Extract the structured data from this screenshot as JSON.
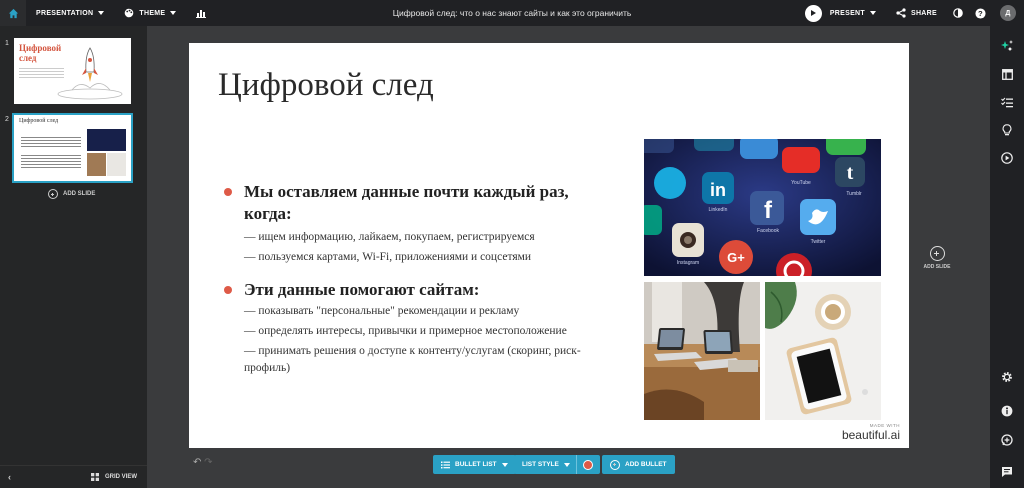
{
  "topbar": {
    "presentation_label": "PRESENTATION",
    "theme_label": "THEME",
    "doc_title": "Цифровой след: что о нас знают сайты и как это ограничить",
    "present_label": "PRESENT",
    "share_label": "SHARE",
    "avatar_initial": "Д"
  },
  "sidebar": {
    "slides": [
      {
        "number": "1",
        "title": "Цифровой след"
      },
      {
        "number": "2",
        "title": "Цифровой след"
      }
    ],
    "add_slide_label": "ADD SLIDE",
    "grid_view_label": "GRID VIEW"
  },
  "slide": {
    "title": "Цифровой след",
    "bullets": [
      {
        "heading": "Мы оставляем данные почти каждый раз, когда:",
        "subs": [
          "— ищем информацию, лайкаем, покупаем, регистрируемся",
          "— пользуемся картами, Wi-Fi, приложениями и соцсетями"
        ]
      },
      {
        "heading": "Эти данные помогают сайтам:",
        "subs": [
          "— показывать \"персональные\" рекомендации и рекламу",
          "— определять интересы, привычки и примерное местоположение",
          "— принимать решения о доступе к контенту/услугам (скоринг, риск-профиль)"
        ]
      }
    ],
    "made_with": "MADE WITH",
    "brand": "beautiful.ai",
    "social_apps": [
      "Whatsapp",
      "Vimeo",
      "YouTube",
      "Tumblr",
      "Vine",
      "LinkedIn",
      "Facebook",
      "Twitter",
      "Instagram",
      "Google+",
      "Pinterest"
    ]
  },
  "add_slide_right_label": "ADD SLIDE",
  "toolbar": {
    "bullet_list_label": "BULLET LIST",
    "list_style_label": "LIST STYLE",
    "add_bullet_label": "ADD BULLET"
  },
  "colors": {
    "accent": "#2aa1c5",
    "bullet": "#de5a47",
    "topbar": "#202124"
  }
}
